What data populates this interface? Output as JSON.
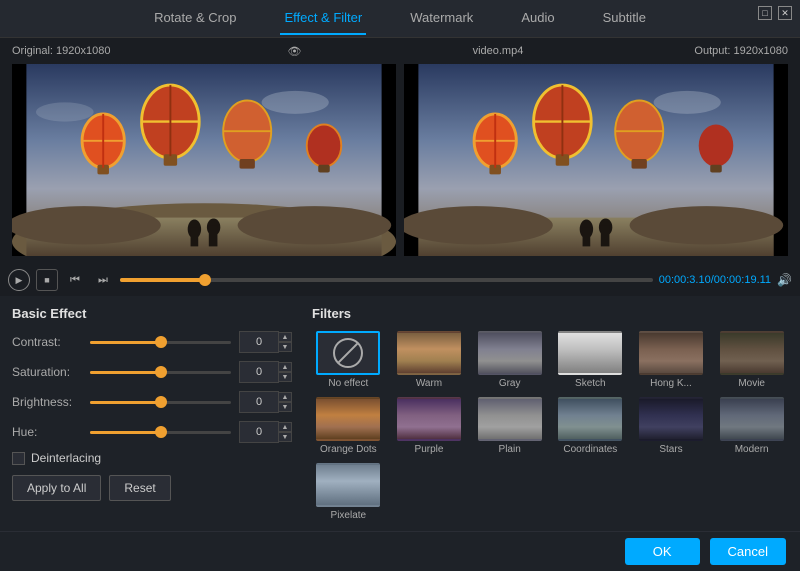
{
  "titleBar": {
    "minimizeLabel": "□",
    "closeLabel": "✕"
  },
  "tabs": [
    {
      "id": "rotate-crop",
      "label": "Rotate & Crop",
      "active": false
    },
    {
      "id": "effect-filter",
      "label": "Effect & Filter",
      "active": true
    },
    {
      "id": "watermark",
      "label": "Watermark",
      "active": false
    },
    {
      "id": "audio",
      "label": "Audio",
      "active": false
    },
    {
      "id": "subtitle",
      "label": "Subtitle",
      "active": false
    }
  ],
  "videoInfo": {
    "originalLabel": "Original: 1920x1080",
    "filename": "video.mp4",
    "outputLabel": "Output: 1920x1080"
  },
  "controls": {
    "playIcon": "▶",
    "stopIcon": "■",
    "prevFrameIcon": "⏮",
    "nextFrameIcon": "⏭",
    "timeDisplay": "00:00:3.10/00:00:19.11",
    "timelinePosition": 16,
    "volumeIcon": "🔊"
  },
  "basicEffect": {
    "title": "Basic Effect",
    "contrast": {
      "label": "Contrast:",
      "value": "0",
      "sliderPos": 50
    },
    "saturation": {
      "label": "Saturation:",
      "value": "0",
      "sliderPos": 50
    },
    "brightness": {
      "label": "Brightness:",
      "value": "0",
      "sliderPos": 50
    },
    "hue": {
      "label": "Hue:",
      "value": "0",
      "sliderPos": 50
    },
    "deinterlacingLabel": "Deinterlacing",
    "applyToAllLabel": "Apply to All",
    "resetLabel": "Reset"
  },
  "filters": {
    "title": "Filters",
    "items": [
      {
        "id": "no-effect",
        "label": "No effect",
        "type": "no-effect",
        "selected": true
      },
      {
        "id": "warm",
        "label": "Warm",
        "type": "warm",
        "selected": false
      },
      {
        "id": "gray",
        "label": "Gray",
        "type": "gray",
        "selected": false
      },
      {
        "id": "sketch",
        "label": "Sketch",
        "type": "sketch",
        "selected": false
      },
      {
        "id": "hongkong",
        "label": "Hong K...",
        "type": "hongkong",
        "selected": false
      },
      {
        "id": "movie",
        "label": "Movie",
        "type": "movie",
        "selected": false
      },
      {
        "id": "orange-dots",
        "label": "Orange Dots",
        "type": "orange",
        "selected": false
      },
      {
        "id": "purple",
        "label": "Purple",
        "type": "purple",
        "selected": false
      },
      {
        "id": "plain",
        "label": "Plain",
        "type": "plain",
        "selected": false
      },
      {
        "id": "coordinates",
        "label": "Coordinates",
        "type": "coord",
        "selected": false
      },
      {
        "id": "stars",
        "label": "Stars",
        "type": "stars",
        "selected": false
      },
      {
        "id": "modern",
        "label": "Modern",
        "type": "modern",
        "selected": false
      },
      {
        "id": "pixelate",
        "label": "Pixelate",
        "type": "pixelate",
        "selected": false
      }
    ]
  },
  "actions": {
    "okLabel": "OK",
    "cancelLabel": "Cancel"
  }
}
